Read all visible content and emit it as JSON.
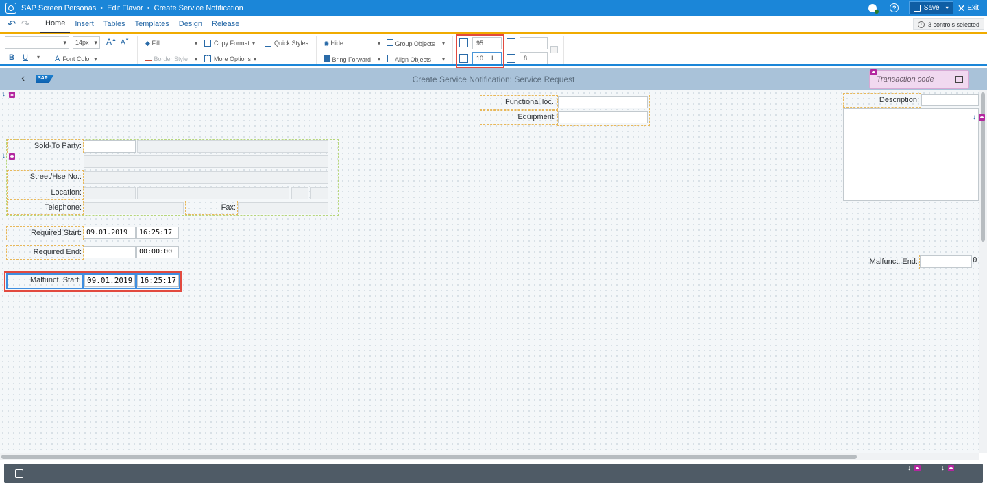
{
  "titlebar": {
    "crumbs": [
      "SAP Screen Personas",
      "Edit Flavor",
      "Create Service Notification"
    ],
    "separator": "•",
    "save_label": "Save",
    "exit_label": "Exit",
    "help_glyph": "?"
  },
  "tabs": {
    "items": [
      "Home",
      "Insert",
      "Tables",
      "Templates",
      "Design",
      "Release"
    ],
    "active": "Home",
    "selected_info": "3 controls selected"
  },
  "ribbon": {
    "font_size": "14px",
    "increase_font": "A",
    "decrease_font": "A",
    "bold": "B",
    "underline": "U",
    "font_color": "Font Color",
    "fill": "Fill",
    "border_style": "Border Style",
    "copy_format": "Copy Format",
    "more_options": "More Options",
    "quick_styles": "Quick Styles",
    "hide": "Hide",
    "bring_forward": "Bring Forward",
    "group_objects": "Group Objects",
    "align_objects": "Align Objects",
    "top": "95",
    "left": "10",
    "width": "",
    "height": "8"
  },
  "app": {
    "title": "Create Service Notification: Service Request",
    "sap_logo": "SAP",
    "tcode_placeholder": "Transaction code"
  },
  "form": {
    "functional_loc_label": "Functional loc.:",
    "equipment_label": "Equipment:",
    "description_label": "Description:",
    "sold_to_label": "Sold-To Party:",
    "street_label": "Street/Hse No.:",
    "location_label": "Location:",
    "telephone_label": "Telephone:",
    "fax_label": "Fax:",
    "required_start_label": "Required Start:",
    "required_start_date": "09.01.2019",
    "required_start_time": "16:25:17",
    "required_end_label": "Required End:",
    "required_end_date": "",
    "required_end_time": "00:00:00",
    "malfunct_start_label": "Malfunct. Start:",
    "malfunct_start_date": "09.01.2019",
    "malfunct_start_time": "16:25:17",
    "malfunct_end_label": "Malfunct. End:",
    "malfunct_end_time_partial": "0"
  },
  "colors": {
    "titlebar": "#1b86d8",
    "accent_orange": "#f0ab00",
    "header_band": "#a9c2d9",
    "selection_red": "#e24a3f",
    "selection_blue": "#3f8edf"
  }
}
